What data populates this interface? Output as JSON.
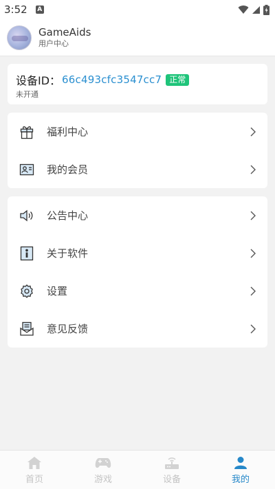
{
  "status_bar": {
    "time": "3:52",
    "app_icon": "A"
  },
  "header": {
    "title": "GameAids",
    "subtitle": "用户中心"
  },
  "device": {
    "label": "设备ID：",
    "id": "66c493cfc3547cc7",
    "status": "正常",
    "subscription": "未开通"
  },
  "menu_group_1": [
    {
      "label": "福利中心",
      "icon": "gift-icon"
    },
    {
      "label": "我的会员",
      "icon": "member-card-icon"
    }
  ],
  "menu_group_2": [
    {
      "label": "公告中心",
      "icon": "speaker-icon"
    },
    {
      "label": "关于软件",
      "icon": "info-icon"
    },
    {
      "label": "设置",
      "icon": "gear-icon"
    },
    {
      "label": "意见反馈",
      "icon": "feedback-icon"
    }
  ],
  "bottom_nav": [
    {
      "label": "首页",
      "icon": "home-icon",
      "active": false
    },
    {
      "label": "游戏",
      "icon": "gamepad-icon",
      "active": false
    },
    {
      "label": "设备",
      "icon": "router-icon",
      "active": false
    },
    {
      "label": "我的",
      "icon": "user-icon",
      "active": true
    }
  ],
  "colors": {
    "accent": "#2688c9",
    "status_ok": "#1fc47a",
    "device_id": "#2a8fd0"
  }
}
